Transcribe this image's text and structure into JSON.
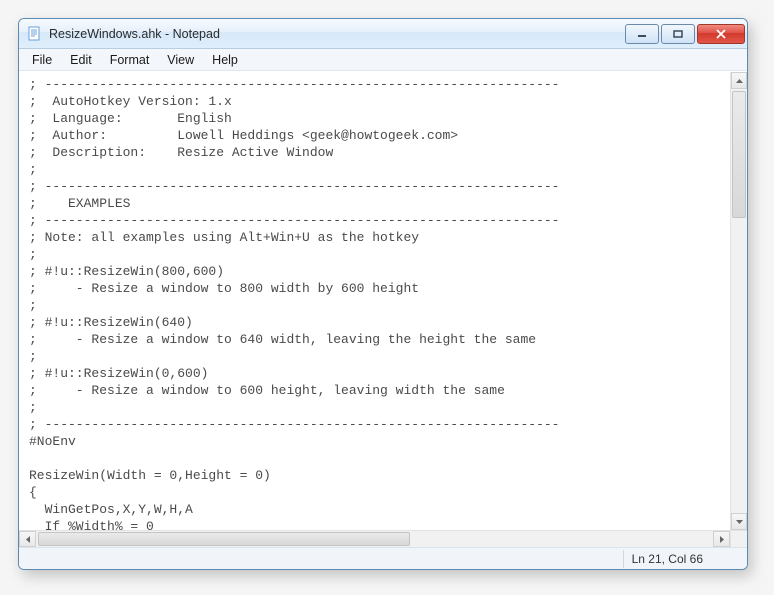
{
  "title": "ResizeWindows.ahk - Notepad",
  "menu": {
    "file": "File",
    "edit": "Edit",
    "format": "Format",
    "view": "View",
    "help": "Help"
  },
  "editor": {
    "content": "; ------------------------------------------------------------------\n;  AutoHotkey Version: 1.x\n;  Language:       English\n;  Author:         Lowell Heddings <geek@howtogeek.com>\n;  Description:    Resize Active Window\n;\n; ------------------------------------------------------------------\n;    EXAMPLES\n; ------------------------------------------------------------------\n; Note: all examples using Alt+Win+U as the hotkey\n;\n; #!u::ResizeWin(800,600)\n;     - Resize a window to 800 width by 600 height\n;\n; #!u::ResizeWin(640)\n;     - Resize a window to 640 width, leaving the height the same\n;\n; #!u::ResizeWin(0,600)\n;     - Resize a window to 600 height, leaving width the same\n;\n; ------------------------------------------------------------------\n#NoEnv\n\nResizeWin(Width = 0,Height = 0)\n{\n  WinGetPos,X,Y,W,H,A\n  If %Width% = 0"
  },
  "status": {
    "position": "Ln 21, Col 66"
  }
}
